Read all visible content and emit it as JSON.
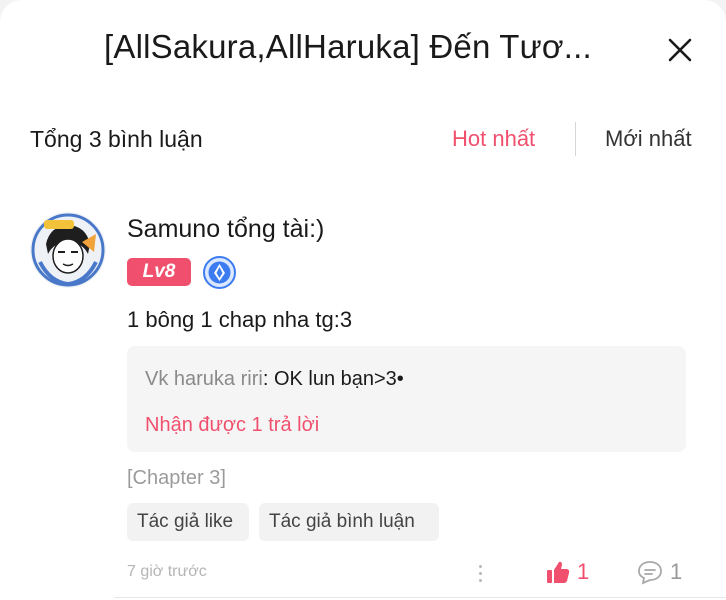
{
  "header": {
    "title": "[AllSakura,AllHaruka] Đến Tươ...",
    "close_icon": "close-icon"
  },
  "sort_bar": {
    "total_label": "Tổng 3 bình luận",
    "hot_label": "Hot nhất",
    "newest_label": "Mới nhất",
    "active_color": "#f0506e"
  },
  "comment": {
    "avatar_icon": "avatar",
    "username": "Samuno tổng tài:)",
    "level": "Lv8",
    "level_color": "#f0506e",
    "tier_icon": "tier-badge-icon",
    "text": "1 bông 1 chap nha tg:3",
    "reply_preview": {
      "author": "Vk haruka riri",
      "separator": ": ",
      "text": "OK lun bạn>3•",
      "count_label": "Nhận được 1 trả lời"
    },
    "chapter": "[Chapter 3]",
    "chips": [
      "Tác giả like",
      "Tác giả bình luận"
    ],
    "timestamp": "7 giờ trước",
    "like_count": "1",
    "reply_count": "1"
  }
}
